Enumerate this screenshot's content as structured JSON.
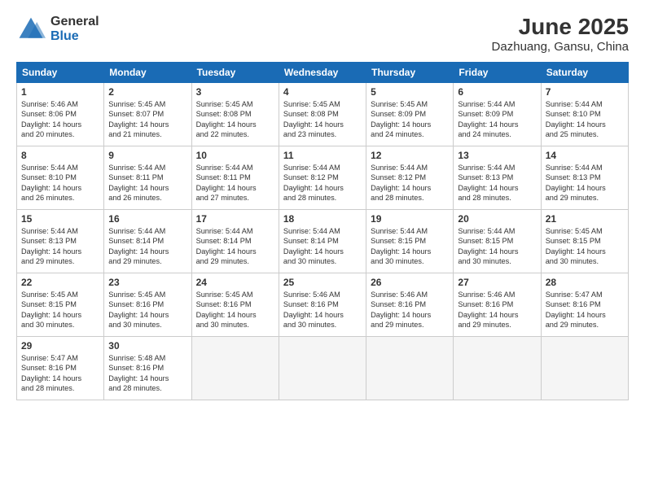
{
  "logo": {
    "general": "General",
    "blue": "Blue"
  },
  "title": "June 2025",
  "location": "Dazhuang, Gansu, China",
  "headers": [
    "Sunday",
    "Monday",
    "Tuesday",
    "Wednesday",
    "Thursday",
    "Friday",
    "Saturday"
  ],
  "weeks": [
    [
      {
        "day": "1",
        "info": "Sunrise: 5:46 AM\nSunset: 8:06 PM\nDaylight: 14 hours\nand 20 minutes."
      },
      {
        "day": "2",
        "info": "Sunrise: 5:45 AM\nSunset: 8:07 PM\nDaylight: 14 hours\nand 21 minutes."
      },
      {
        "day": "3",
        "info": "Sunrise: 5:45 AM\nSunset: 8:08 PM\nDaylight: 14 hours\nand 22 minutes."
      },
      {
        "day": "4",
        "info": "Sunrise: 5:45 AM\nSunset: 8:08 PM\nDaylight: 14 hours\nand 23 minutes."
      },
      {
        "day": "5",
        "info": "Sunrise: 5:45 AM\nSunset: 8:09 PM\nDaylight: 14 hours\nand 24 minutes."
      },
      {
        "day": "6",
        "info": "Sunrise: 5:44 AM\nSunset: 8:09 PM\nDaylight: 14 hours\nand 24 minutes."
      },
      {
        "day": "7",
        "info": "Sunrise: 5:44 AM\nSunset: 8:10 PM\nDaylight: 14 hours\nand 25 minutes."
      }
    ],
    [
      {
        "day": "8",
        "info": "Sunrise: 5:44 AM\nSunset: 8:10 PM\nDaylight: 14 hours\nand 26 minutes."
      },
      {
        "day": "9",
        "info": "Sunrise: 5:44 AM\nSunset: 8:11 PM\nDaylight: 14 hours\nand 26 minutes."
      },
      {
        "day": "10",
        "info": "Sunrise: 5:44 AM\nSunset: 8:11 PM\nDaylight: 14 hours\nand 27 minutes."
      },
      {
        "day": "11",
        "info": "Sunrise: 5:44 AM\nSunset: 8:12 PM\nDaylight: 14 hours\nand 28 minutes."
      },
      {
        "day": "12",
        "info": "Sunrise: 5:44 AM\nSunset: 8:12 PM\nDaylight: 14 hours\nand 28 minutes."
      },
      {
        "day": "13",
        "info": "Sunrise: 5:44 AM\nSunset: 8:13 PM\nDaylight: 14 hours\nand 28 minutes."
      },
      {
        "day": "14",
        "info": "Sunrise: 5:44 AM\nSunset: 8:13 PM\nDaylight: 14 hours\nand 29 minutes."
      }
    ],
    [
      {
        "day": "15",
        "info": "Sunrise: 5:44 AM\nSunset: 8:13 PM\nDaylight: 14 hours\nand 29 minutes."
      },
      {
        "day": "16",
        "info": "Sunrise: 5:44 AM\nSunset: 8:14 PM\nDaylight: 14 hours\nand 29 minutes."
      },
      {
        "day": "17",
        "info": "Sunrise: 5:44 AM\nSunset: 8:14 PM\nDaylight: 14 hours\nand 29 minutes."
      },
      {
        "day": "18",
        "info": "Sunrise: 5:44 AM\nSunset: 8:14 PM\nDaylight: 14 hours\nand 30 minutes."
      },
      {
        "day": "19",
        "info": "Sunrise: 5:44 AM\nSunset: 8:15 PM\nDaylight: 14 hours\nand 30 minutes."
      },
      {
        "day": "20",
        "info": "Sunrise: 5:44 AM\nSunset: 8:15 PM\nDaylight: 14 hours\nand 30 minutes."
      },
      {
        "day": "21",
        "info": "Sunrise: 5:45 AM\nSunset: 8:15 PM\nDaylight: 14 hours\nand 30 minutes."
      }
    ],
    [
      {
        "day": "22",
        "info": "Sunrise: 5:45 AM\nSunset: 8:15 PM\nDaylight: 14 hours\nand 30 minutes."
      },
      {
        "day": "23",
        "info": "Sunrise: 5:45 AM\nSunset: 8:16 PM\nDaylight: 14 hours\nand 30 minutes."
      },
      {
        "day": "24",
        "info": "Sunrise: 5:45 AM\nSunset: 8:16 PM\nDaylight: 14 hours\nand 30 minutes."
      },
      {
        "day": "25",
        "info": "Sunrise: 5:46 AM\nSunset: 8:16 PM\nDaylight: 14 hours\nand 30 minutes."
      },
      {
        "day": "26",
        "info": "Sunrise: 5:46 AM\nSunset: 8:16 PM\nDaylight: 14 hours\nand 29 minutes."
      },
      {
        "day": "27",
        "info": "Sunrise: 5:46 AM\nSunset: 8:16 PM\nDaylight: 14 hours\nand 29 minutes."
      },
      {
        "day": "28",
        "info": "Sunrise: 5:47 AM\nSunset: 8:16 PM\nDaylight: 14 hours\nand 29 minutes."
      }
    ],
    [
      {
        "day": "29",
        "info": "Sunrise: 5:47 AM\nSunset: 8:16 PM\nDaylight: 14 hours\nand 28 minutes."
      },
      {
        "day": "30",
        "info": "Sunrise: 5:48 AM\nSunset: 8:16 PM\nDaylight: 14 hours\nand 28 minutes."
      },
      null,
      null,
      null,
      null,
      null
    ]
  ]
}
